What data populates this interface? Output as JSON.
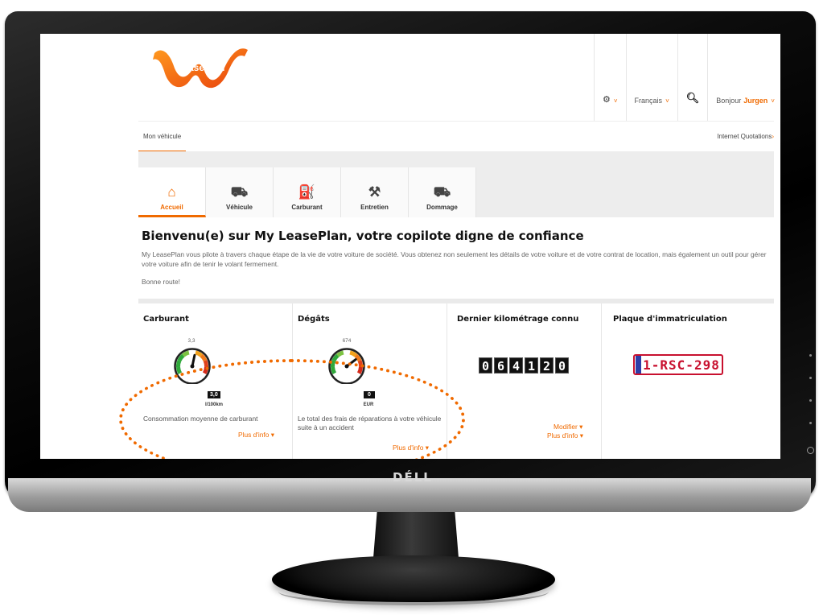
{
  "brand": {
    "name": "LeasePlan"
  },
  "monitor": {
    "logo": "DÉLL"
  },
  "header": {
    "language": "Français",
    "greeting": "Bonjour",
    "user": "Jurgen",
    "chevron": "˅"
  },
  "subnav": {
    "tab": "Mon véhicule",
    "link": "Internet Quotations",
    "link_arrow": "›"
  },
  "tabs": [
    {
      "label": "Accueil",
      "icon": "home-icon",
      "glyph": "⌂"
    },
    {
      "label": "Véhicule",
      "icon": "car-icon",
      "glyph": "⛟"
    },
    {
      "label": "Carburant",
      "icon": "fuel-pump-icon",
      "glyph": "⛽"
    },
    {
      "label": "Entretien",
      "icon": "tools-icon",
      "glyph": "⚒"
    },
    {
      "label": "Dommage",
      "icon": "car-damage-icon",
      "glyph": "⛟"
    }
  ],
  "main": {
    "title": "Bienvenu(e) sur My LeasePlan, votre copilote digne de confiance",
    "intro": "My LeasePlan vous pilote à travers chaque étape de la vie de votre voiture de société. Vous obtenez non seulement les détails de votre voiture et de votre contrat de location, mais également un outil pour gérer votre voiture afin de tenir le volant fermement.",
    "sign_off": "Bonne route!"
  },
  "cards": {
    "fuel": {
      "title": "Carburant",
      "gauge_top": "3,3",
      "gauge_value": "3,0",
      "gauge_unit": "l/100km",
      "gauge_fraction": 0.55,
      "text": "Consommation moyenne de carburant",
      "more": "Plus d'info ▾"
    },
    "damage": {
      "title": "Dégâts",
      "gauge_top": "674",
      "gauge_value": "0",
      "gauge_unit": "EUR",
      "gauge_fraction": 0.72,
      "text": "Le total des frais de réparations à votre véhicule suite à un accident",
      "more": "Plus d'info ▾"
    },
    "mileage": {
      "title": "Dernier kilométrage connu",
      "digits": [
        "0",
        "6",
        "4",
        "1",
        "2",
        "0"
      ],
      "modify": "Modifier ▾",
      "more": "Plus d'info ▾"
    },
    "plate": {
      "title": "Plaque d'immatriculation",
      "number": "1-RSC-298"
    }
  },
  "colors": {
    "accent": "#f06a00",
    "plate_red": "#c8102e",
    "plate_blue": "#2d3ea8"
  }
}
